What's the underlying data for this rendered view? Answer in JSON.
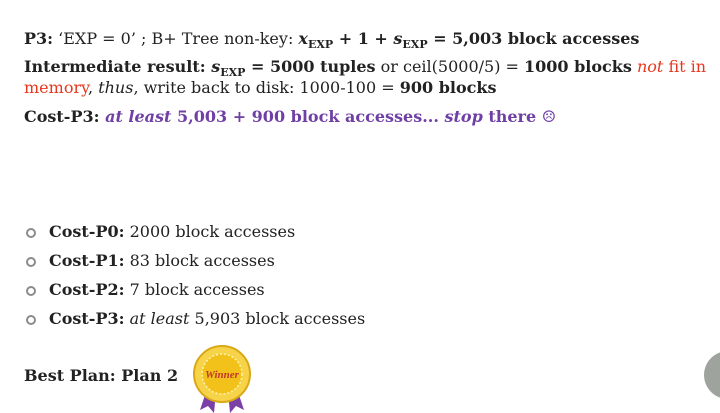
{
  "p3_line": {
    "label": "P3:",
    "cond": " ‘EXP = 0’ ; B+ Tree non-key: ",
    "x_var": "x",
    "x_sub": "EXP",
    "plus_one": " + 1 + ",
    "s_var": "s",
    "s_sub": "EXP",
    "result": " = 5,003 block accesses"
  },
  "intermediate": {
    "label": "Intermediate result: ",
    "s_var": "s",
    "s_sub": "EXP",
    "tuples": " = 5000 tuples",
    "or_ceil": " or ceil(5000/5) = ",
    "blocks": "1000 blocks",
    "not_fit_a": "not",
    "not_fit_b": " fit in",
    "memory": "memory",
    "comma": ", ",
    "thus": "thus",
    "write_back": ", write back to disk: 1000-100 = ",
    "result": "900 blocks"
  },
  "cost_p3_line": {
    "label": "Cost-P3: ",
    "at_least": "at least",
    "sum": " 5,003 + 900 block accesses... ",
    "stop": "stop",
    "there": " there ☹"
  },
  "costs": [
    {
      "label": "Cost-P0:",
      "value": " 2000 block accesses",
      "italic": ""
    },
    {
      "label": "Cost-P1:",
      "value": " 83 block accesses",
      "italic": ""
    },
    {
      "label": "Cost-P2:",
      "value": " 7 block accesses",
      "italic": ""
    },
    {
      "label": "Cost-P3:",
      "italic": " at least",
      "value": " 5,903 block accesses"
    }
  ],
  "best_plan": "Best Plan: Plan 2",
  "badge": {
    "text": "Winner",
    "icon": "winner-medal-icon"
  },
  "colors": {
    "purple": "#6f3fa6",
    "red": "#e8371e",
    "gold": "#f2c21b",
    "ribbon": "#7b3fa8"
  }
}
